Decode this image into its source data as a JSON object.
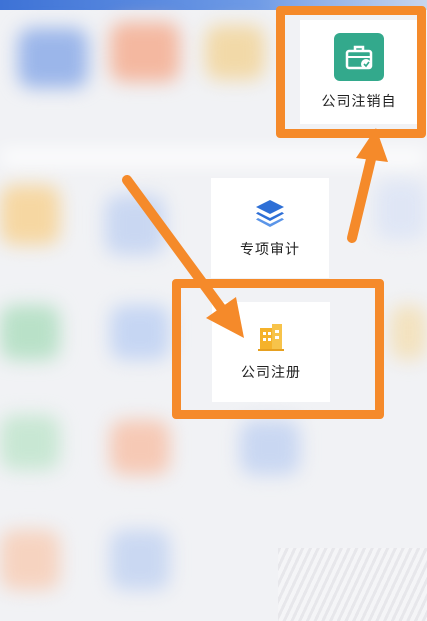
{
  "menu": {
    "special_audit_label": "专项审计",
    "company_registration_label": "公司注册",
    "company_deregistration_label": "公司注销自"
  },
  "colors": {
    "highlight": "#f58a2a",
    "audit_icon": "#2e6fd6",
    "registration_icon": "#f5b22a",
    "deregistration_icon": "#33a98c"
  },
  "icons": {
    "special_audit": "layers-icon",
    "company_registration": "building-icon",
    "company_deregistration": "briefcase-icon"
  }
}
